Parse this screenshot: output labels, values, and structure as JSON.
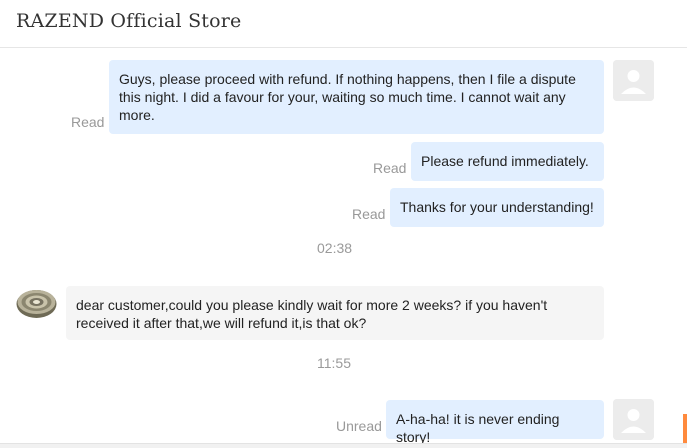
{
  "header": {
    "title": "RAZEND Official Store"
  },
  "messages": [
    {
      "status": "Read",
      "text": "Guys, please proceed with refund. If nothing happens, then I file a dispute this night. I did a favour for your, waiting so much time. I cannot wait any more."
    },
    {
      "status": "Read",
      "text": "Please refund immediately."
    },
    {
      "status": "Read",
      "text": "Thanks for your understanding!"
    },
    {
      "time": "02:38"
    },
    {
      "text": "dear customer,could you please kindly wait for more 2 weeks? if you haven't received it after that,we will refund it,is that ok?"
    },
    {
      "time": "11:55"
    },
    {
      "status": "Unread",
      "text": "A-ha-ha! it is never ending story!"
    }
  ],
  "colors": {
    "outgoing_bubble": "#e2efff",
    "incoming_bubble": "#f5f5f5",
    "accent": "#ff8a3d"
  },
  "icons": {
    "user_avatar": "user-avatar-placeholder",
    "store_avatar": "led-strip-reel"
  }
}
